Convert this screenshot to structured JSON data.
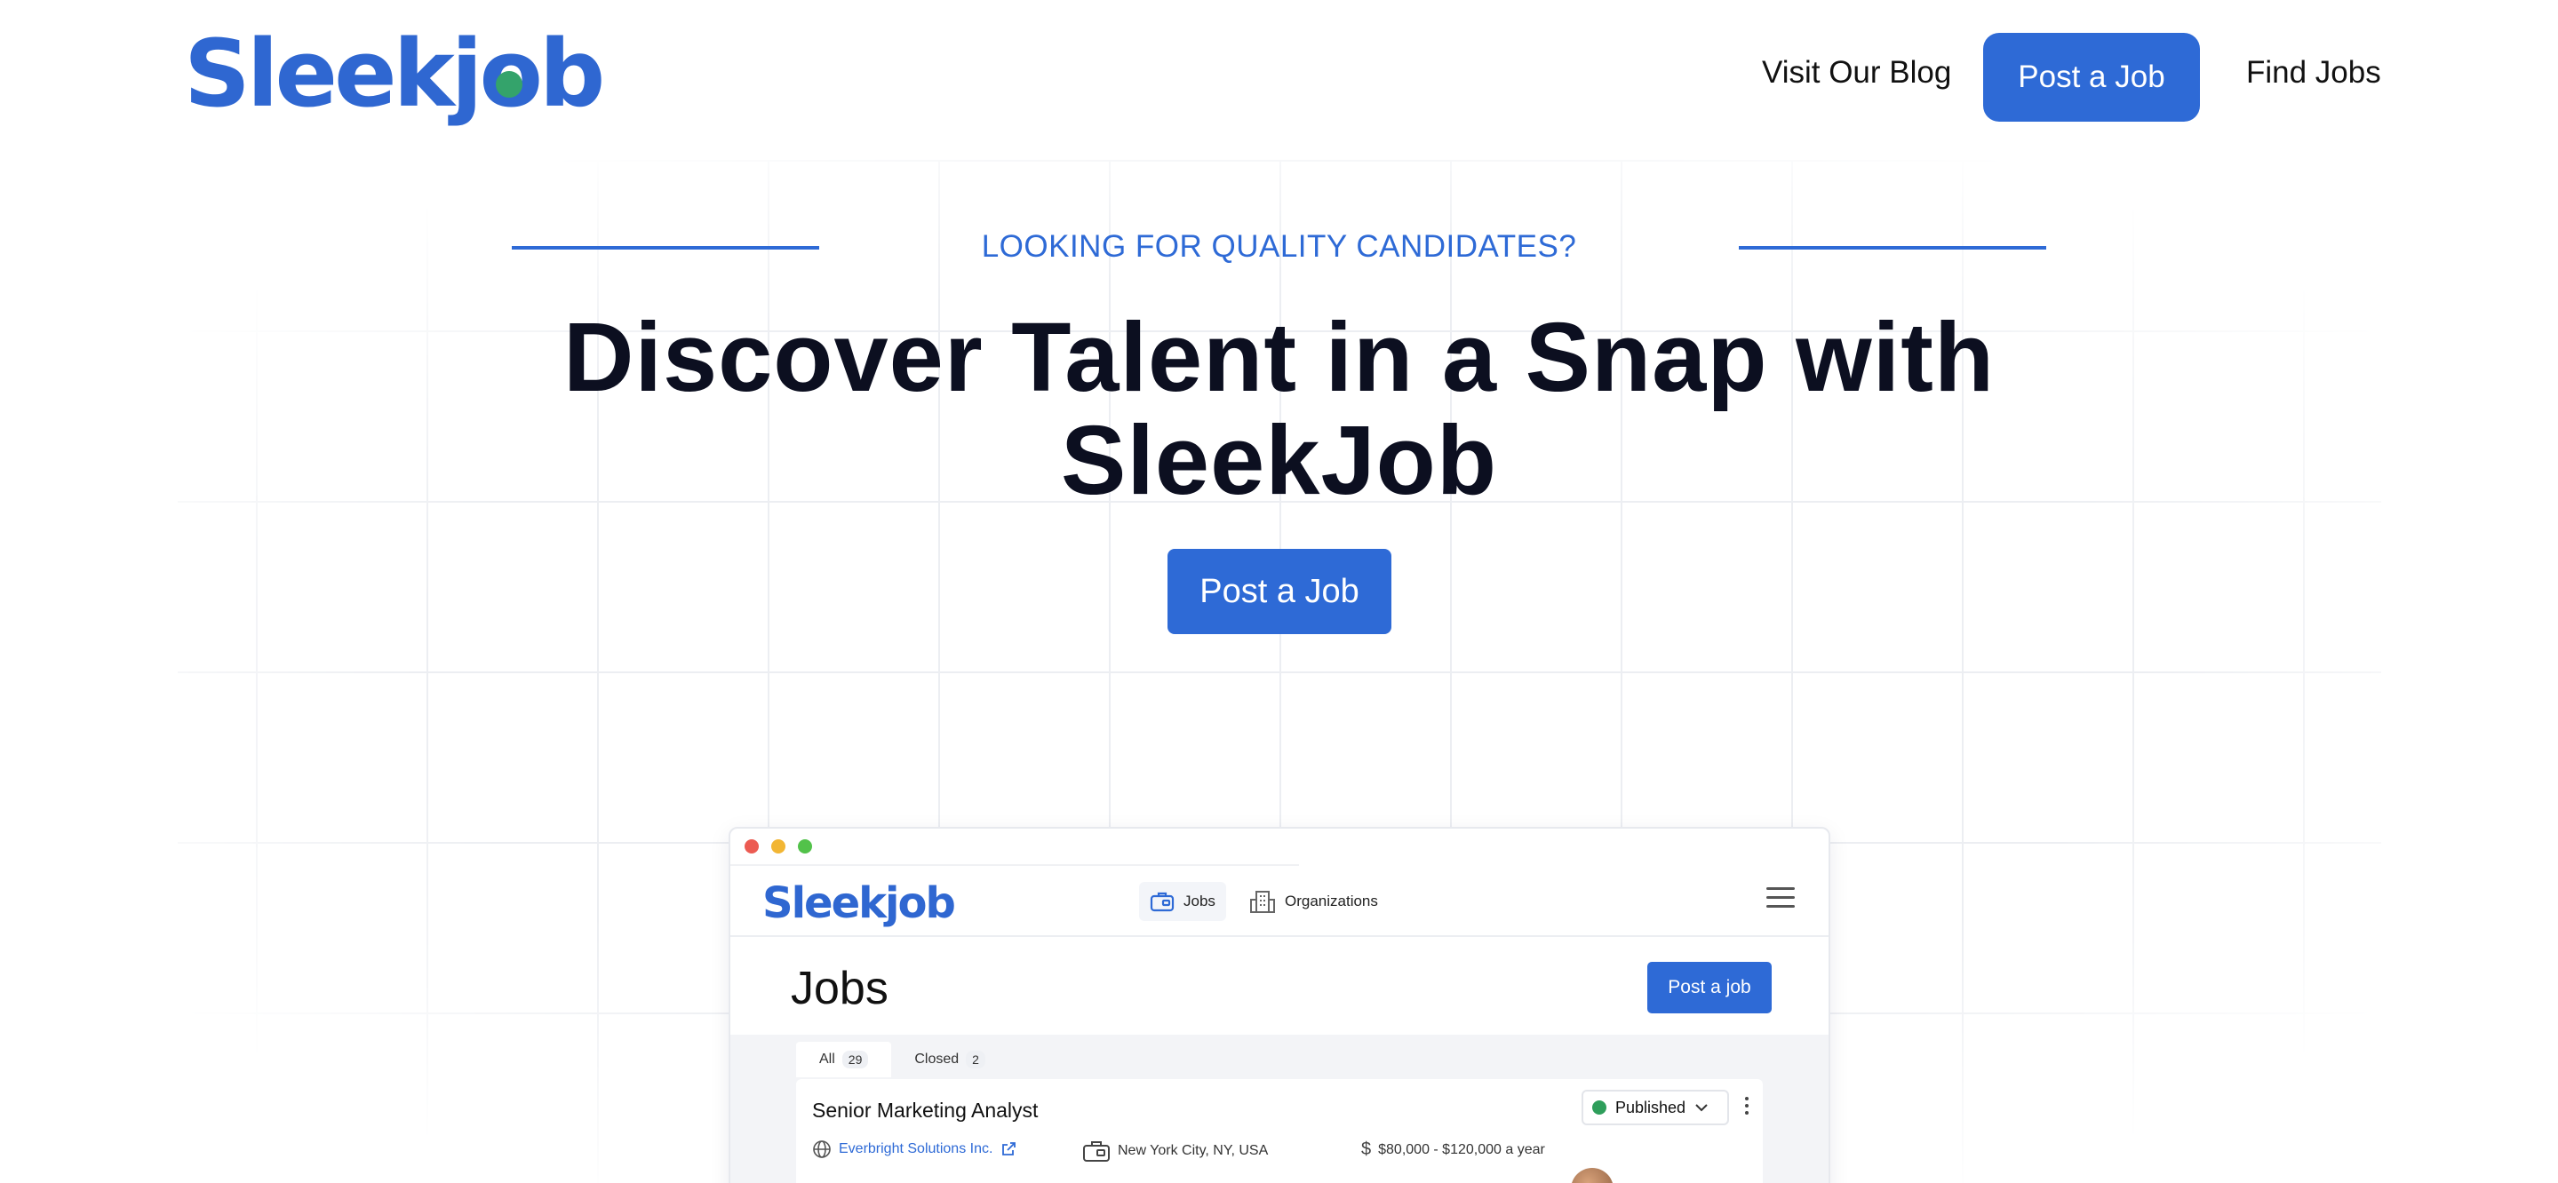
{
  "header": {
    "logo_text": "Sleekjob",
    "nav": {
      "blog_label": "Visit Our Blog",
      "post_job_label": "Post a Job",
      "find_jobs_label": "Find Jobs"
    }
  },
  "hero": {
    "eyebrow": "LOOKING FOR QUALITY CANDIDATES?",
    "title_line1": "Discover Talent in a Snap with",
    "title_line2": "SleekJob",
    "cta_label": "Post a Job"
  },
  "preview": {
    "logo_text": "Sleekjob",
    "nav_tabs": [
      {
        "label": "Jobs",
        "icon": "briefcase-icon"
      },
      {
        "label": "Organizations",
        "icon": "building-icon"
      }
    ],
    "page_title": "Jobs",
    "post_button_label": "Post a job",
    "filter_tabs": [
      {
        "label": "All",
        "count": "29"
      },
      {
        "label": "Closed",
        "count": "2"
      }
    ],
    "job": {
      "title": "Senior Marketing Analyst",
      "organization": "Everbright Solutions Inc.",
      "location": "New York City, NY, USA",
      "salary": "$80,000 - $120,000 a year",
      "status": "Published"
    }
  },
  "colors": {
    "brand_blue": "#2e6ad6",
    "logo_accent_green": "#34a36b",
    "status_green": "#2e9e5b"
  }
}
